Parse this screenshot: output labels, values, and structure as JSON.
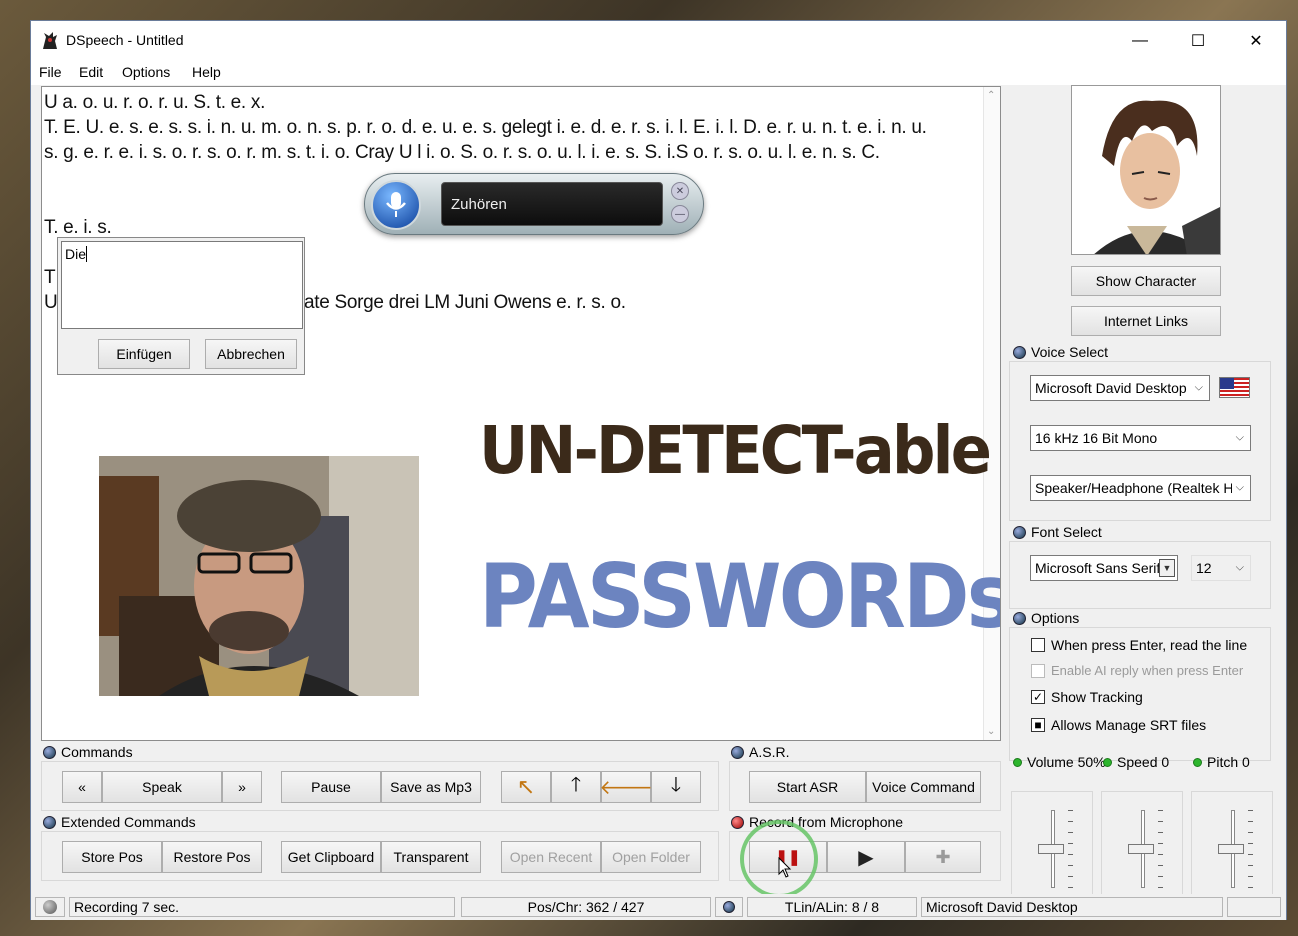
{
  "window": {
    "title": "DSpeech - Untitled",
    "minimize_glyph": "—",
    "maximize_glyph": "☐",
    "close_glyph": "✕"
  },
  "menu": [
    "File",
    "Edit",
    "Options",
    "Help"
  ],
  "editor": {
    "lines": [
      "U a. o. u. r. o. r. u. S. t. e. x.",
      "T. E. U. e. s. e. s. s. i. n. u. m. o. n. s. p. r. o. d. e. u. e. s. gelegt i. e. d. e. r. s. i. l. E. i. l. D. e. r. u. n. t. e. i. n. u.",
      "s. g. e. r. e. i. s. o. r. s. o. r. m. s. t. i. o. Cray U l i. o. S. o. r. s. o. u. l. i. e. s. S. i.S o. r. s. o. u. l. e. n. s. C.",
      "T. e. i. s.",
      "T",
      "U",
      "ate Sorge drei LM Juni Owens e. r. s. o."
    ],
    "scroll_up": "⌃",
    "scroll_down": "⌄"
  },
  "asr_widget": {
    "status": "Zuhören",
    "close": "✕",
    "minimize": "—"
  },
  "insert_dialog": {
    "text": "Die",
    "insert_label": "Einfügen",
    "cancel_label": "Abbrechen"
  },
  "overlay": {
    "line1": "UN-DETECT-able",
    "line2": "PASSWORDs",
    "color1": "#3b2a1a",
    "color2": "#6c84c0"
  },
  "character": {
    "show_label": "Show Character",
    "links_label": "Internet Links"
  },
  "voice_select": {
    "label": "Voice Select",
    "voice": "Microsoft David Desktop",
    "format": "16 kHz 16 Bit Mono",
    "device": "Speaker/Headphone (Realtek H"
  },
  "font_select": {
    "label": "Font Select",
    "font": "Microsoft Sans Serif",
    "size": "12"
  },
  "options": {
    "label": "Options",
    "items": [
      {
        "label": "When press Enter, read the line",
        "checked": "",
        "disabled": false
      },
      {
        "label": "Enable AI reply when press Enter",
        "checked": "",
        "disabled": true
      },
      {
        "label": "Show Tracking",
        "checked": "✓",
        "disabled": false
      },
      {
        "label": "Allows Manage SRT files",
        "checked": "■",
        "disabled": false
      }
    ]
  },
  "commands": {
    "label": "Commands",
    "prev": "«",
    "speak": "Speak",
    "next": "»",
    "pause": "Pause",
    "save_mp3": "Save as Mp3",
    "arrows": [
      "↖",
      "🡑",
      "🡐",
      "🡓"
    ]
  },
  "asr": {
    "label": "A.S.R.",
    "start": "Start ASR",
    "voice_command": "Voice Command"
  },
  "extended": {
    "label": "Extended Commands",
    "store_pos": "Store Pos",
    "restore_pos": "Restore Pos",
    "get_clipboard": "Get Clipboard",
    "transparent": "Transparent",
    "open_recent": "Open Recent",
    "open_folder": "Open Folder"
  },
  "record": {
    "label": "Record from Microphone",
    "pause_glyph": "❚❚",
    "play_glyph": "▶",
    "add_glyph": "✚"
  },
  "sliders": [
    {
      "label": "Volume 50%",
      "level": 0.5
    },
    {
      "label": "Speed 0",
      "level": 0.5
    },
    {
      "label": "Pitch 0",
      "level": 0.5
    }
  ],
  "status": {
    "recording": "Recording 7 sec.",
    "pos": "Pos/Chr: 362 / 427",
    "lines": "TLin/ALin: 8 / 8",
    "voice": "Microsoft David Desktop"
  }
}
